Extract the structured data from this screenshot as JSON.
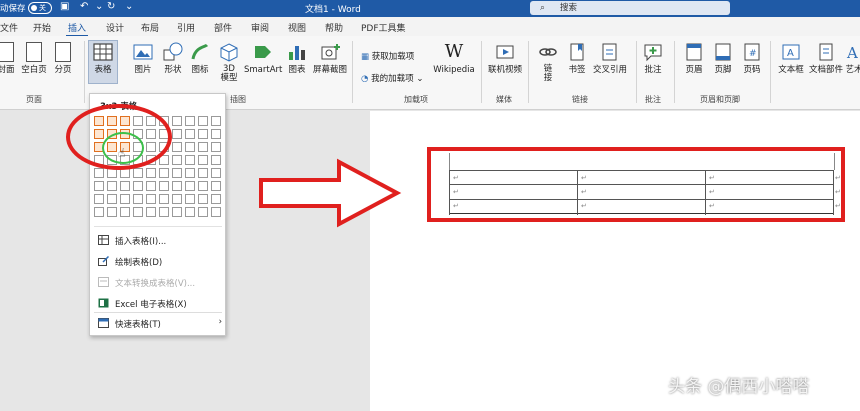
{
  "titlebar": {
    "autosave": "动保存",
    "autosave_state": "关",
    "doc_title": "文档1 - Word",
    "search_placeholder": "搜索",
    "accent": "#1f5aa6"
  },
  "tabs": [
    "文件",
    "开始",
    "插入",
    "设计",
    "布局",
    "引用",
    "部件",
    "审阅",
    "视图",
    "帮助",
    "PDF工具集"
  ],
  "active_tab": "插入",
  "ribbon": {
    "buttons": {
      "cover": "封面",
      "blank": "空白页",
      "break": "分页",
      "table": "表格",
      "picture": "图片",
      "shape": "形状",
      "icon": "图标",
      "model3d_1": "3D",
      "model3d_2": "模型",
      "smartart": "SmartArt",
      "chart": "图表",
      "screenshot": "屏幕截图",
      "get_addin": "获取加载项",
      "my_addin": "我的加载项",
      "wikipedia": "Wikipedia",
      "online_video": "联机视频",
      "link_1": "链",
      "link_2": "接",
      "bookmark": "书签",
      "crossref": "交叉引用",
      "comment": "批注",
      "header": "页眉",
      "footer": "页脚",
      "pagenum": "页码",
      "textbox": "文本框",
      "quickparts": "文档部件",
      "art": "艺术"
    },
    "groups": {
      "pages": "页面",
      "illustrations": "插图",
      "addins": "加载项",
      "media": "媒体",
      "links": "链接",
      "comments": "批注",
      "header_footer": "页眉和页脚"
    }
  },
  "dropdown": {
    "title": "3x3 表格",
    "grid_cols": 10,
    "grid_rows": 8,
    "selected_cols": 3,
    "selected_rows": 3,
    "items": [
      {
        "label": "插入表格(I)...",
        "icon": "insert-table-icon",
        "disabled": false
      },
      {
        "label": "绘制表格(D)",
        "icon": "draw-table-icon",
        "disabled": false
      },
      {
        "label": "文本转换成表格(V)...",
        "icon": "convert-text-icon",
        "disabled": true
      },
      {
        "label": "Excel 电子表格(X)",
        "icon": "excel-icon",
        "disabled": false
      },
      {
        "label": "快速表格(T)",
        "icon": "quick-table-icon",
        "disabled": false
      }
    ]
  },
  "table_preview": {
    "rows": 3,
    "cols": 3,
    "cell_mark": "↵"
  },
  "watermark": "头条 @偶西小嗒嗒",
  "colors": {
    "annotation_red": "#e0201e",
    "highlight_green": "#3cc04a",
    "grid_selected": "#e07020"
  }
}
